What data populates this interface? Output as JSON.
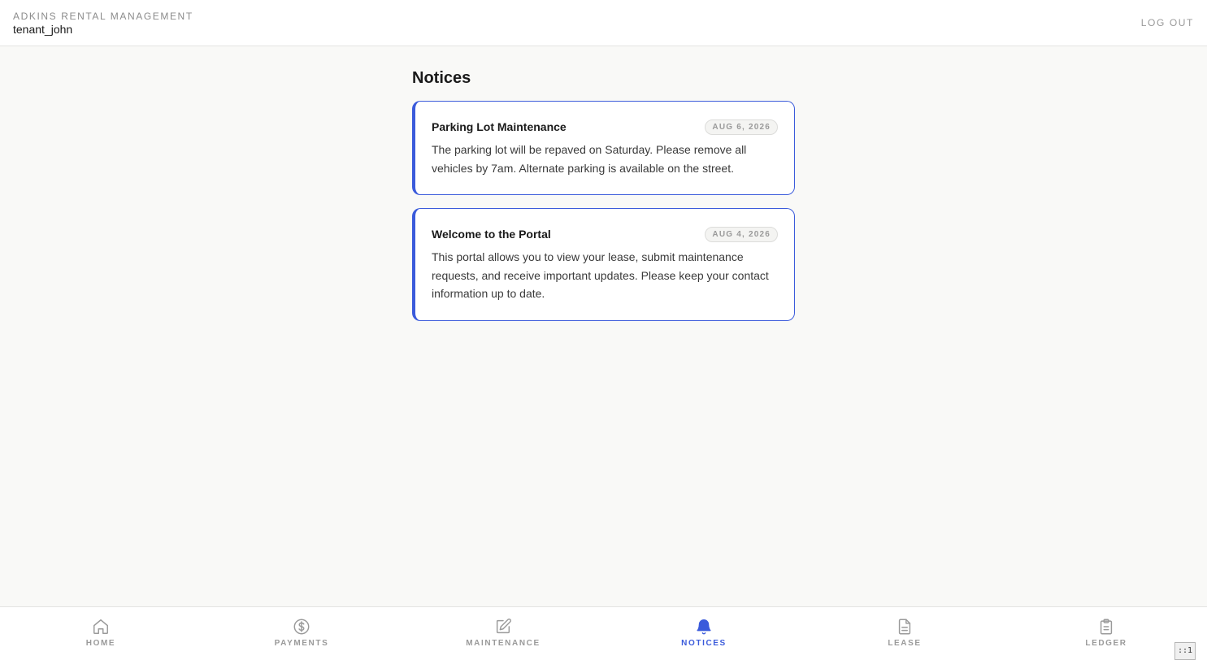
{
  "header": {
    "brand": "ADKINS RENTAL MANAGEMENT",
    "username": "tenant_john",
    "logout_label": "LOG OUT"
  },
  "main": {
    "title": "Notices",
    "notices": [
      {
        "title": "Parking Lot Maintenance",
        "date": "AUG 6, 2026",
        "body": "The parking lot will be repaved on Saturday. Please remove all vehicles by 7am. Alternate parking is available on the street."
      },
      {
        "title": "Welcome to the Portal",
        "date": "AUG 4, 2026",
        "body": "This portal allows you to view your lease, submit maintenance requests, and receive important updates. Please keep your contact information up to date."
      }
    ]
  },
  "nav": {
    "items": [
      {
        "label": "HOME",
        "icon": "home-icon",
        "active": false
      },
      {
        "label": "PAYMENTS",
        "icon": "dollar-icon",
        "active": false
      },
      {
        "label": "MAINTENANCE",
        "icon": "edit-icon",
        "active": false
      },
      {
        "label": "NOTICES",
        "icon": "bell-icon",
        "active": true
      },
      {
        "label": "LEASE",
        "icon": "document-icon",
        "active": false
      },
      {
        "label": "LEDGER",
        "icon": "clipboard-icon",
        "active": false
      }
    ]
  },
  "corner_badge": "::1",
  "colors": {
    "accent": "#3b5bdb",
    "muted": "#9a9a9a",
    "background": "#f9f9f7"
  }
}
